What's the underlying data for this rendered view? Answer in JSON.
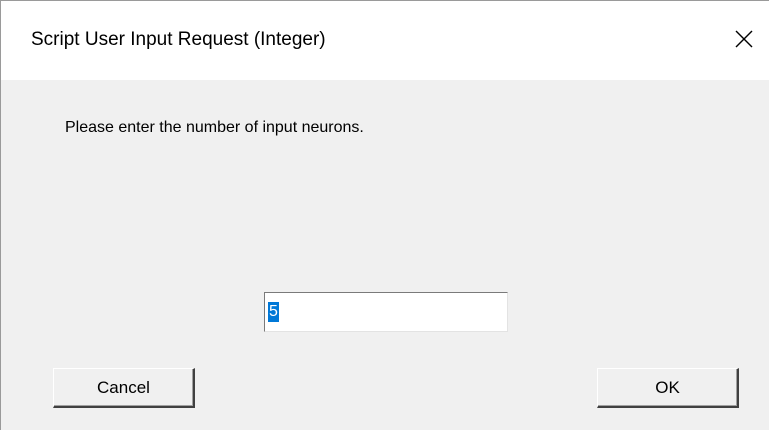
{
  "window": {
    "title": "Script User Input Request (Integer)",
    "close_icon": "close-icon"
  },
  "dialog": {
    "prompt": "Please enter the number of input neurons.",
    "input_value": "5",
    "cancel_label": "Cancel",
    "ok_label": "OK"
  },
  "colors": {
    "client_background": "#f0f0f0",
    "titlebar_background": "#ffffff",
    "selection_highlight": "#0078d7"
  }
}
